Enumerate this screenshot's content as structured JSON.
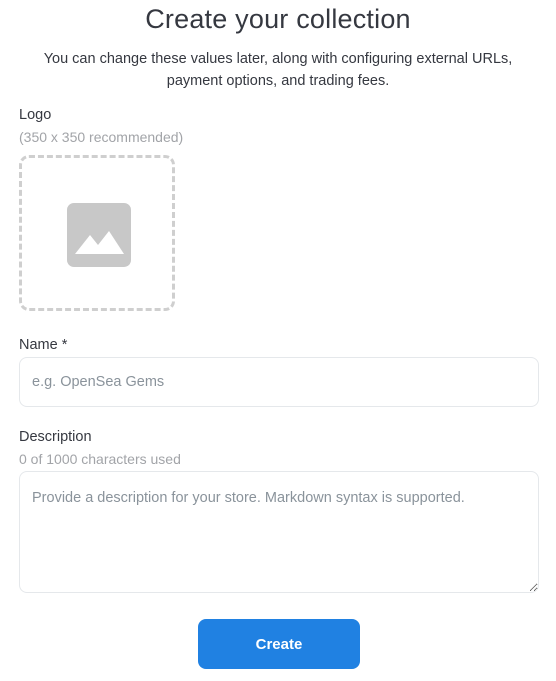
{
  "header": {
    "title": "Create your collection",
    "subtitle": "You can change these values later, along with configuring external URLs, payment options, and trading fees."
  },
  "logo": {
    "label": "Logo",
    "hint": "(350 x 350 recommended)",
    "icon": "image-placeholder-icon"
  },
  "name": {
    "label": "Name *",
    "placeholder": "e.g. OpenSea Gems",
    "value": ""
  },
  "description": {
    "label": "Description",
    "counter": "0 of 1000 characters used",
    "placeholder": "Provide a description for your store. Markdown syntax is supported.",
    "value": ""
  },
  "actions": {
    "create_label": "Create"
  },
  "colors": {
    "accent": "#2081e2",
    "icon_gray": "#c8c8c8",
    "border": "#e5e8eb"
  }
}
